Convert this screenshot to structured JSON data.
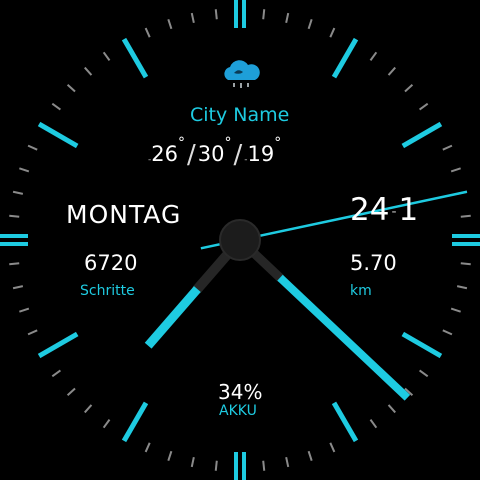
{
  "weather": {
    "icon": "rain-cloud-icon",
    "city": "City Name",
    "temp_low": "26",
    "temp_current": "30",
    "temp_high": "19",
    "degree_symbol": "°"
  },
  "date": {
    "weekday": "MONTAG",
    "day": "24",
    "month": "1",
    "separator": "-"
  },
  "stats": {
    "steps_value": "6720",
    "steps_label": "Schritte",
    "distance_value": "5.70",
    "distance_label": "km",
    "battery_value": "34%",
    "battery_label": "AKKU"
  },
  "colors": {
    "accent": "#1ecbe1",
    "background": "#000000",
    "text": "#ffffff",
    "hub": "#1c1c1c"
  },
  "time": {
    "hour": 7,
    "minute": 22,
    "second": 13
  }
}
